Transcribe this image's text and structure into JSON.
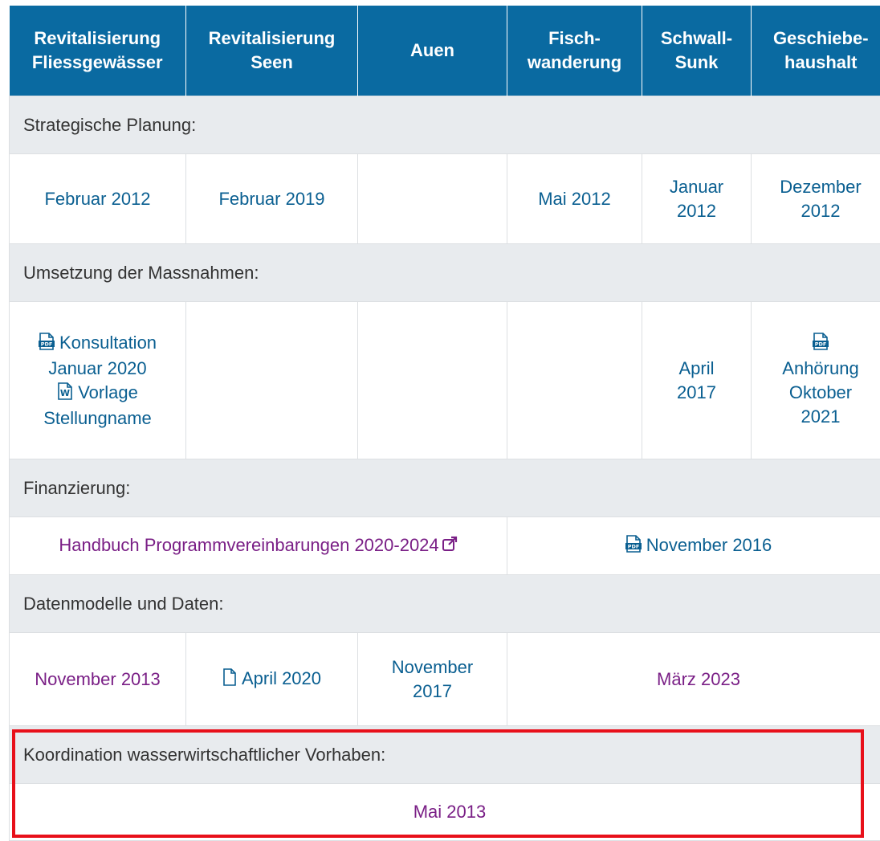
{
  "header": {
    "columns": [
      [
        "Revitalisierung",
        "Fliessgewässer"
      ],
      [
        "Revitalisierung",
        "Seen"
      ],
      [
        "Auen"
      ],
      [
        "Fisch-",
        "wanderung"
      ],
      [
        "Schwall-",
        "Sunk"
      ],
      [
        "Geschiebe-",
        "haushalt"
      ]
    ]
  },
  "sections": {
    "strategic": "Strategische Planung:",
    "measures": "Umsetzung der Massnahmen:",
    "financing": "Finanzierung:",
    "data": "Datenmodelle und Daten:",
    "coordination": "Koordination wasserwirtschaftlicher Vorhaben:"
  },
  "strategic_row": {
    "c1": "Februar 2012",
    "c2": "Februar 2019",
    "c4": "Mai 2012",
    "c5": [
      "Januar",
      "2012"
    ],
    "c6": [
      "Dezember",
      "2012"
    ]
  },
  "measures_row": {
    "c1": {
      "consult": "Konsultation",
      "consult_date": "Januar 2020",
      "template": "Vorlage",
      "template2": "Stellungname"
    },
    "c5": [
      "April",
      "2017"
    ],
    "c6": [
      "Anhörung",
      "Oktober",
      "2021"
    ]
  },
  "financing_row": {
    "handbook": "Handbuch Programmvereinbarungen 2020-2024",
    "november": "November 2016"
  },
  "data_row": {
    "c1": "November 2013",
    "c2": "April 2020",
    "c3": [
      "November",
      "2017"
    ],
    "c4": "März 2023"
  },
  "coordination_row": {
    "value": "Mai 2013"
  },
  "icons": {
    "pdf": "pdf-file-icon",
    "word": "word-file-icon",
    "file": "file-outline-icon",
    "external": "external-link-icon"
  },
  "colors": {
    "header_bg": "#0a6aa1",
    "link_blue": "#0a5f91",
    "visited_purple": "#7a1f86",
    "section_bg": "#e8ebee",
    "highlight": "#e8101a"
  }
}
